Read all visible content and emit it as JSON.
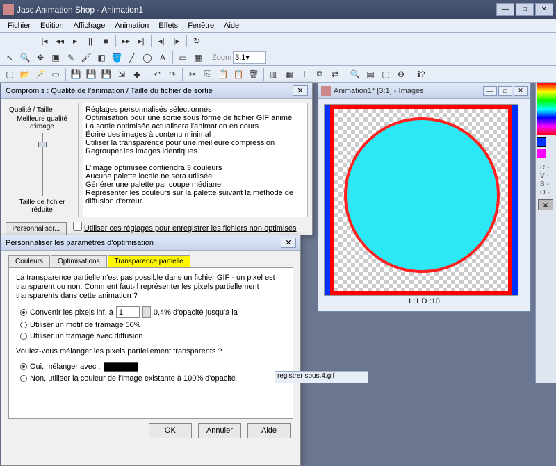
{
  "app": {
    "title": "Jasc Animation Shop - Animation1"
  },
  "menu": [
    "Fichier",
    "Edition",
    "Affichage",
    "Animation",
    "Effets",
    "Fenêtre",
    "Aide"
  ],
  "zoom_label": "Zoom",
  "zoom_value": "3:1",
  "child": {
    "title": "Animation1* [3:1] - Images",
    "frame_label": "I :1   D :10"
  },
  "palette_letters": [
    "R -",
    "V -",
    "B -",
    "O -"
  ],
  "dlg1": {
    "title": "Compromis : Qualité de l'animation / Taille du fichier de sortie",
    "qt_label": "Qualité / Taille",
    "best": "Meilleure qualité d'image",
    "small": "Taille de fichier réduite",
    "summary": "Réglages personnalisés sélectionnés\nOptimisation pour une sortie sous forme de fichier GIF animé\nLa sortie optimisée actualisera l'animation en cours\nÉcrire des images à contenu minimal\nUtiliser la transparence pour une meilleure compression\nRegrouper les images identiques\n\nL'image optimisée contiendra 3 couleurs\nAucune palette locale ne sera utilisée\nGénérer une palette par coupe médiane\nReprésenter les couleurs sur la palette suivant la méthode de diffusion d'erreur.",
    "customize": "Personnaliser...",
    "save_chk": "Utiliser ces réglages pour enregistrer les fichiers non optimisés"
  },
  "dlg2": {
    "title": "Personnaliser les paramètres d'optimisation",
    "tabs": [
      "Couleurs",
      "Optimisations",
      "Transparence partielle"
    ],
    "intro": "La transparence partielle n'est pas possible dans un fichier GIF - un pixel est transparent ou non. Comment faut-il représenter les pixels partiellement transparents dans cette animation ?",
    "r1": "Convertir les pixels inf. à",
    "r1_val": "1",
    "r1_tail": "0,4% d'opacité jusqu'à la",
    "r2": "Utiliser un motif de tramage 50%",
    "r3": "Utiliser un tramage avec diffusion",
    "q2": "Voulez-vous mélanger les pixels partiellement transparents ?",
    "r4": "Oui, mélanger avec :",
    "r5": "Non, utiliser la couleur de l'image existante à 100% d'opacité",
    "ok": "OK",
    "cancel": "Annuler",
    "help": "Aide"
  },
  "status_frag": "registrer sous.4.gif"
}
